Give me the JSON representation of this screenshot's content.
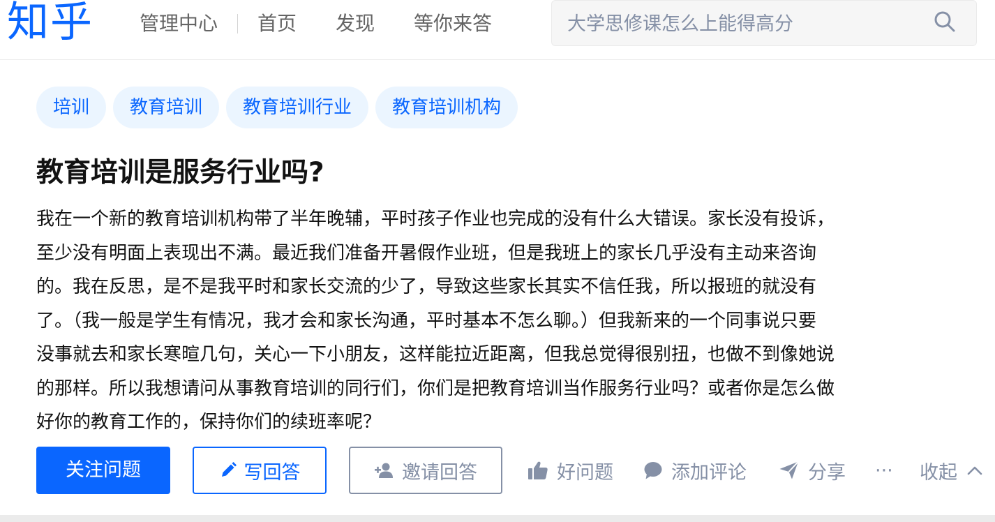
{
  "header": {
    "logo": "知乎",
    "nav": {
      "admin": "管理中心",
      "home": "首页",
      "discover": "发现",
      "waiting": "等你来答"
    },
    "search": {
      "placeholder": "大学思修课怎么上能得高分"
    }
  },
  "question": {
    "tags": [
      "培训",
      "教育培训",
      "教育培训行业",
      "教育培训机构"
    ],
    "title": "教育培训是服务行业吗?",
    "body_lines": [
      "我在一个新的教育培训机构带了半年晚辅，平时孩子作业也完成的没有什么大错误。家长没有投诉，",
      "至少没有明面上表现出不满。最近我们准备开暑假作业班，但是我班上的家长几乎没有主动来咨询",
      "的。我在反思，是不是我平时和家长交流的少了，导致这些家长其实不信任我，所以报班的就没有",
      "了。（我一般是学生有情况，我才会和家长沟通，平时基本不怎么聊。）但我新来的一个同事说只要",
      "没事就去和家长寒暄几句，关心一下小朋友，这样能拉近距离，但我总觉得很别扭，也做不到像她说",
      "的那样。所以我想请问从事教育培训的同行们，你们是把教育培训当作服务行业吗？或者你是怎么做",
      "好你的教育工作的，保持你们的续班率呢？"
    ],
    "actions": {
      "follow": "关注问题",
      "write": "写回答",
      "invite": "邀请回答",
      "good": "好问题",
      "comment": "添加评论",
      "share": "分享",
      "more": "···",
      "collapse": "收起"
    }
  },
  "colors": {
    "brand": "#0a66ff",
    "muted": "#8590a6"
  }
}
